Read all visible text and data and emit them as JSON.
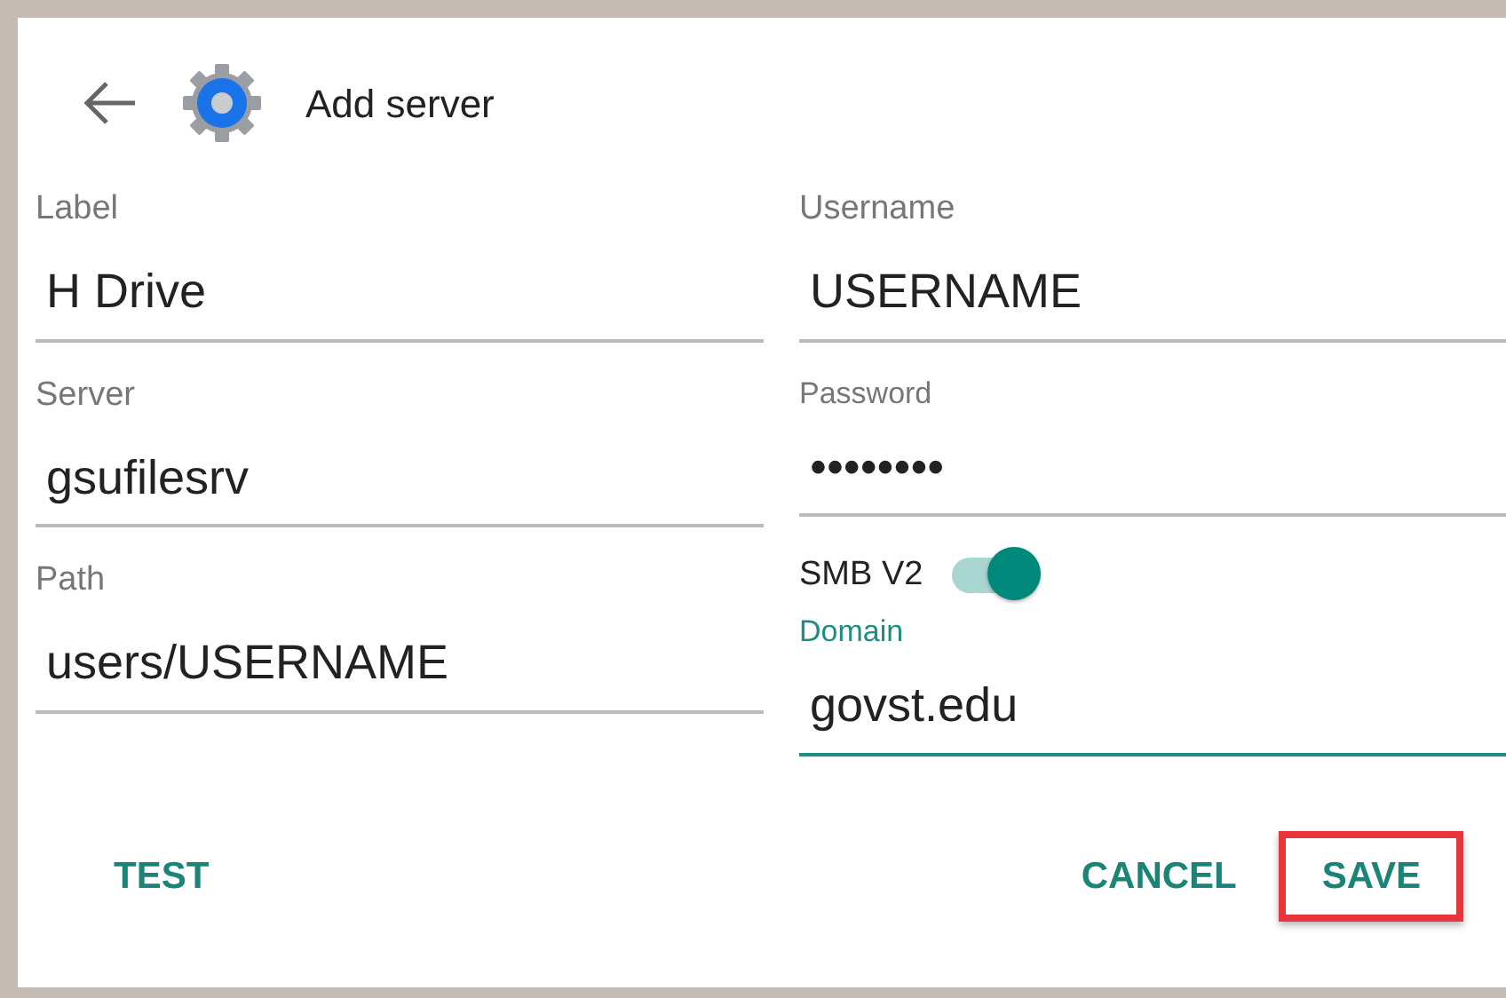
{
  "header": {
    "title": "Add server"
  },
  "left_fields": [
    {
      "label": "Label",
      "value": "H Drive",
      "focused": false
    },
    {
      "label": "Server",
      "value": "gsufilesrv",
      "focused": false
    },
    {
      "label": "Path",
      "value": "users/USERNAME",
      "focused": false
    }
  ],
  "right_items": [
    {
      "kind": "field",
      "label": "Username",
      "value": "USERNAME",
      "focused": false
    },
    {
      "kind": "compact",
      "label": "Password",
      "value": "••••••••",
      "focused": false
    },
    {
      "kind": "switch",
      "label": "SMB V2",
      "on": true
    },
    {
      "kind": "compact",
      "label": "Domain",
      "value": "govst.edu",
      "focused": true
    }
  ],
  "buttons": [
    {
      "label": "TEST",
      "highlighted": false
    },
    {
      "label": "CANCEL",
      "highlighted": false
    },
    {
      "label": "SAVE",
      "highlighted": true
    }
  ]
}
